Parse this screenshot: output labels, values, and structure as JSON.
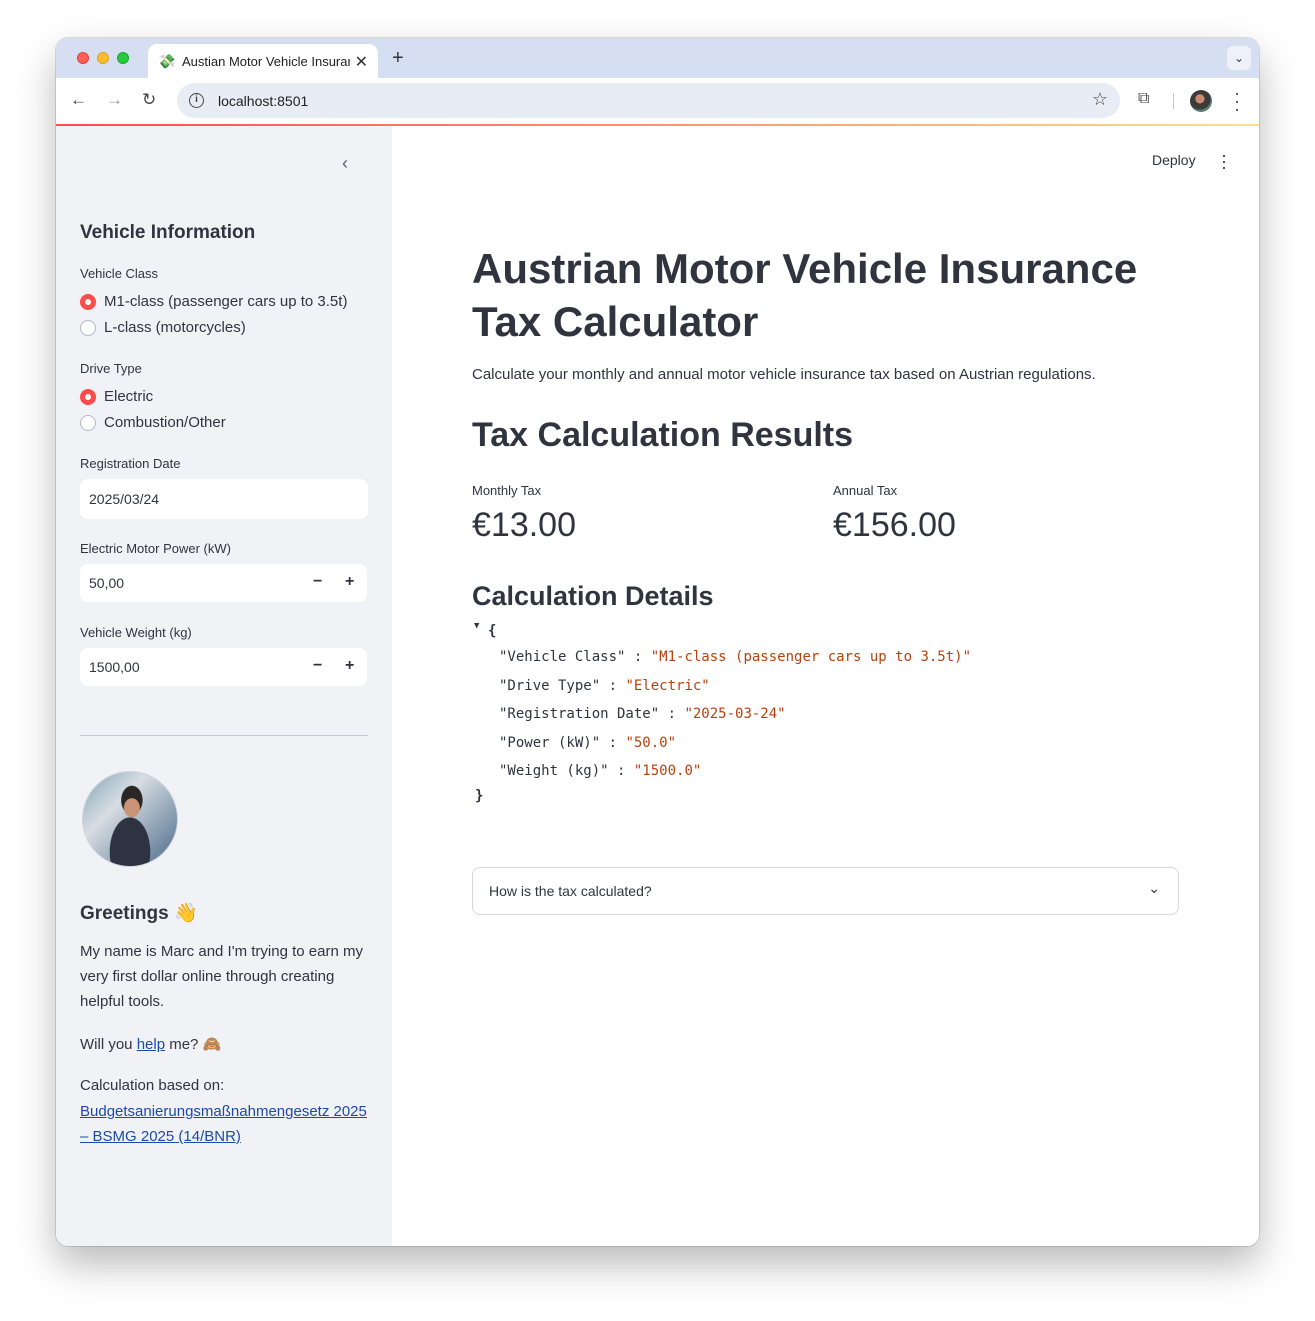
{
  "browser": {
    "tab_title": "Austian Motor Vehicle Insurance",
    "tab_icon": "money-icon",
    "url": "localhost:8501"
  },
  "sidebar": {
    "section_title": "Vehicle Information",
    "vehicle_class": {
      "label": "Vehicle Class",
      "options": [
        "M1-class (passenger cars up to 3.5t)",
        "L-class (motorcycles)"
      ],
      "selected": 0
    },
    "drive_type": {
      "label": "Drive Type",
      "options": [
        "Electric",
        "Combustion/Other"
      ],
      "selected": 0
    },
    "registration_date": {
      "label": "Registration Date",
      "value": "2025/03/24"
    },
    "power": {
      "label": "Electric Motor Power (kW)",
      "value": "50,00"
    },
    "weight": {
      "label": "Vehicle Weight (kg)",
      "value": "1500,00"
    },
    "greetings_title": "Greetings 👋",
    "greetings_text": "My name is Marc and I'm trying to earn my very first dollar online through creating helpful tools.",
    "help_prefix": "Will you ",
    "help_link": "help",
    "help_suffix": " me? 🙈",
    "source_label": "Calculation based on:",
    "source_link": "Budgetsanierungsmaßnahmengesetz 2025 – BSMG 2025 (14/BNR)"
  },
  "header": {
    "deploy_label": "Deploy"
  },
  "main": {
    "title": "Austrian Motor Vehicle Insurance Tax Calculator",
    "intro": "Calculate your monthly and annual motor vehicle insurance tax based on Austrian regulations.",
    "results_title": "Tax Calculation Results",
    "monthly_label": "Monthly Tax",
    "monthly_value": "€13.00",
    "annual_label": "Annual Tax",
    "annual_value": "€156.00",
    "details_title": "Calculation Details",
    "details": [
      {
        "key": "\"Vehicle Class\"",
        "value": "\"M1-class (passenger cars up to 3.5t)\""
      },
      {
        "key": "\"Drive Type\"",
        "value": "\"Electric\""
      },
      {
        "key": "\"Registration Date\"",
        "value": "\"2025-03-24\""
      },
      {
        "key": "\"Power (kW)\"",
        "value": "\"50.0\""
      },
      {
        "key": "\"Weight (kg)\"",
        "value": "\"1500.0\""
      }
    ],
    "json_open": "{",
    "json_close": "}",
    "expander_label": "How is the tax calculated?"
  },
  "colors": {
    "accent": "#ff4b4b",
    "link": "#1c4aa8",
    "json_value": "#b5420f"
  }
}
